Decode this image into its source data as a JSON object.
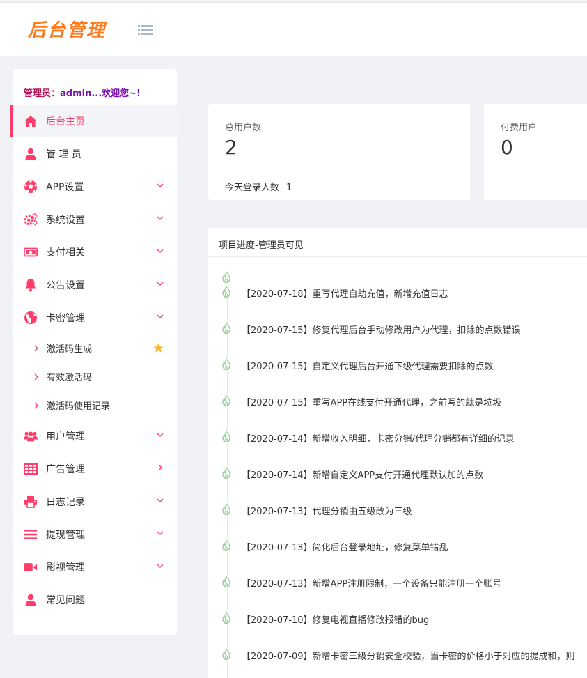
{
  "header": {
    "logo_text": "后台管理",
    "menu_toggle_icon": "list-icon"
  },
  "sidebar": {
    "admin_prefix": "管理员：",
    "admin_name": "admin...欢迎您~!",
    "items": [
      {
        "label": "后台主页",
        "icon": "home-icon",
        "active": true
      },
      {
        "label": "管 理 员",
        "icon": "user-icon"
      },
      {
        "label": "APP设置",
        "icon": "soccer-ball-icon",
        "chevron": "down"
      },
      {
        "label": "系统设置",
        "icon": "gears-icon",
        "chevron": "down"
      },
      {
        "label": "支付相关",
        "icon": "money-icon",
        "chevron": "down"
      },
      {
        "label": "公告设置",
        "icon": "bell-icon",
        "chevron": "down"
      },
      {
        "label": "卡密管理",
        "icon": "globe-icon",
        "chevron": "down"
      },
      {
        "label": "用户管理",
        "icon": "users-icon",
        "chevron": "down"
      },
      {
        "label": "广告管理",
        "icon": "table-icon",
        "chevron": "right"
      },
      {
        "label": "日志记录",
        "icon": "printer-icon",
        "chevron": "down"
      },
      {
        "label": "提现管理",
        "icon": "bars-icon",
        "chevron": "down"
      },
      {
        "label": "影视管理",
        "icon": "video-camera-icon",
        "chevron": "down"
      },
      {
        "label": "常见问题",
        "icon": "user-icon"
      }
    ],
    "subitems": [
      {
        "label": "激活码生成",
        "starred": true
      },
      {
        "label": "有效激活码"
      },
      {
        "label": "激活码使用记录"
      }
    ]
  },
  "stats": {
    "total_users_label": "总用户数",
    "total_users_value": "2",
    "today_login_label": "今天登录人数",
    "today_login_value": "1",
    "paid_users_label": "付费用户",
    "paid_users_value": "0"
  },
  "progress": {
    "title": "项目进度-管理员可见",
    "entries": [
      "【2020-07-18】重写代理自助充值，新增充值日志",
      "【2020-07-15】修复代理后台手动修改用户为代理，扣除的点数错误",
      "【2020-07-15】自定义代理后台开通下级代理需要扣除的点数",
      "【2020-07-15】重写APP在线支付开通代理，之前写的就是垃圾",
      "【2020-07-14】新增收入明细，卡密分销/代理分销都有详细的记录",
      "【2020-07-14】新增自定义APP支付开通代理默认加的点数",
      "【2020-07-13】代理分销由五级改为三级",
      "【2020-07-13】简化后台登录地址，修复菜单错乱",
      "【2020-07-13】新增APP注册限制，一个设备只能注册一个账号",
      "【2020-07-10】修复电视直播修改报错的bug",
      "【2020-07-09】新增卡密三级分销安全校验，当卡密的价格小于对应的提成和，则"
    ]
  },
  "colors": {
    "accent": "#ff3d6a",
    "logo": "#ff7a1a",
    "timeline_icon": "#8fcf8f"
  }
}
